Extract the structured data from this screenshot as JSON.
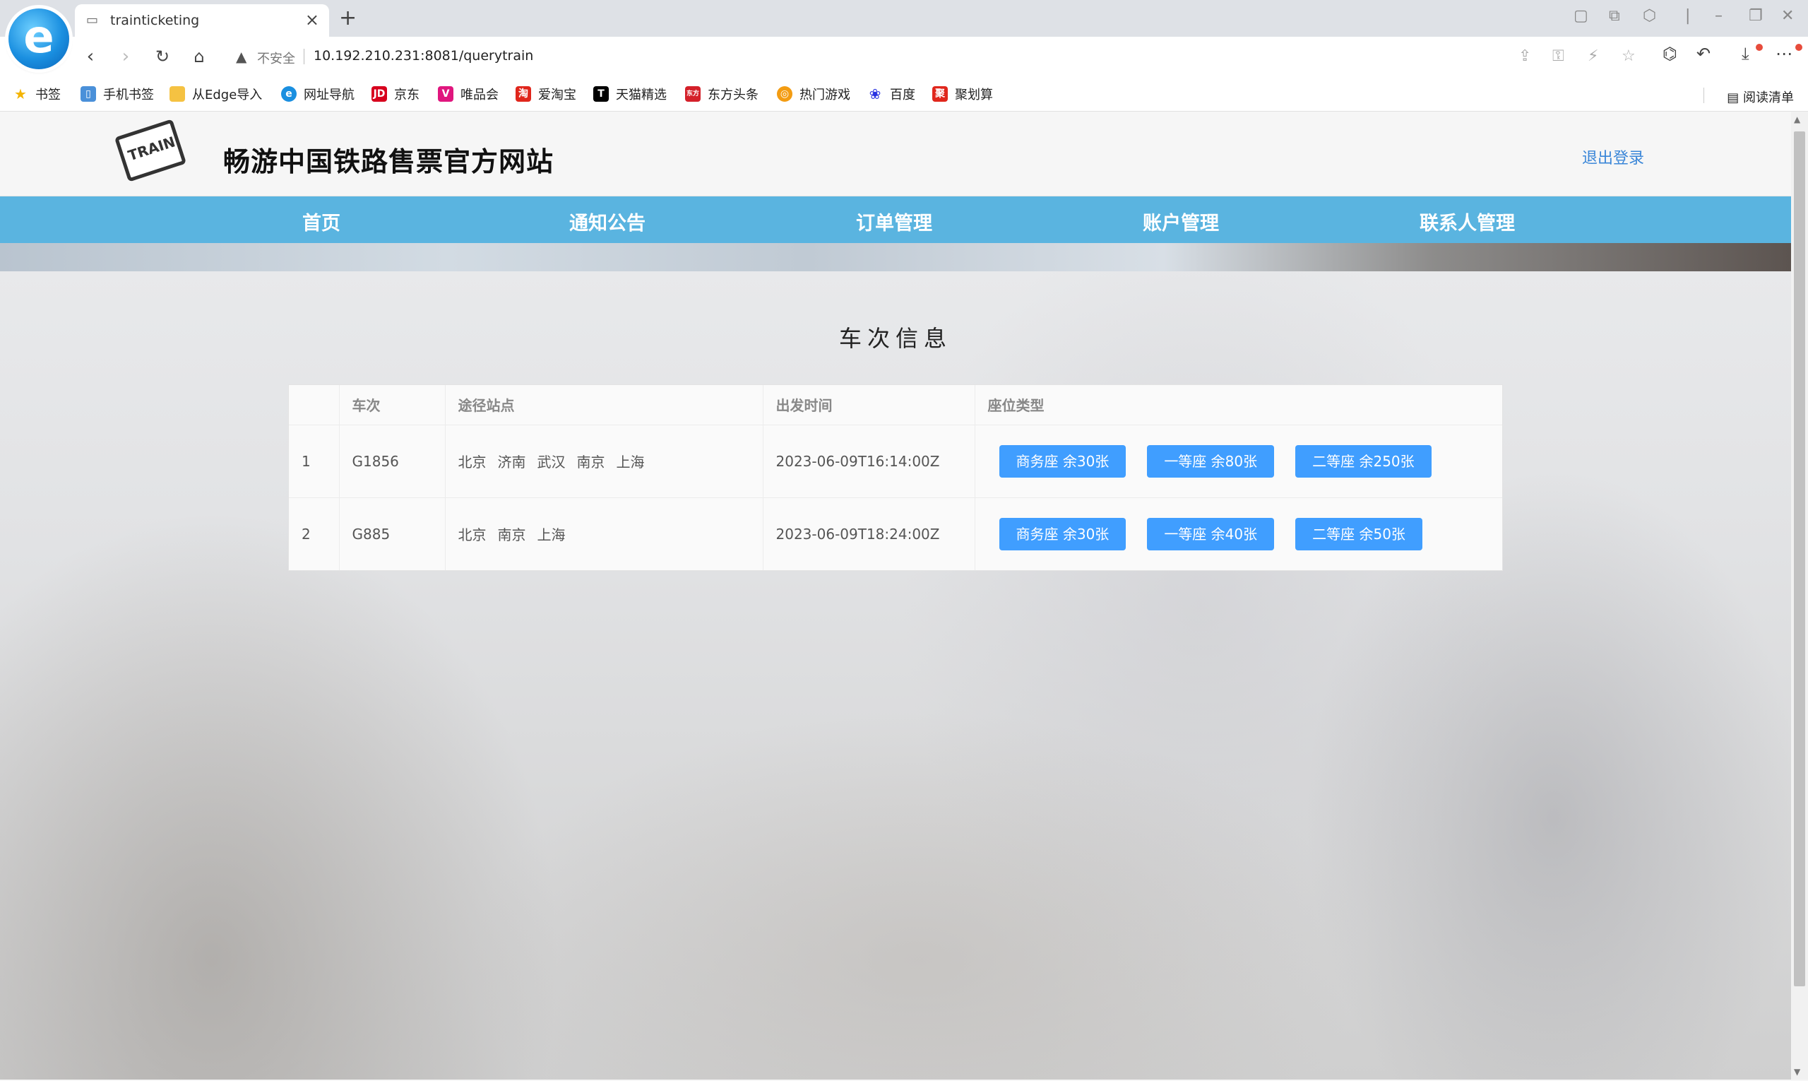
{
  "browser": {
    "tab_title": "trainticketing",
    "insecure_label": "不安全",
    "url": "10.192.210.231:8081/querytrain",
    "bookmarks": [
      {
        "label": "书签"
      },
      {
        "label": "手机书签"
      },
      {
        "label": "从Edge导入"
      },
      {
        "label": "网址导航"
      },
      {
        "label": "京东"
      },
      {
        "label": "唯品会"
      },
      {
        "label": "爱淘宝"
      },
      {
        "label": "天猫精选"
      },
      {
        "label": "东方头条"
      },
      {
        "label": "热门游戏"
      },
      {
        "label": "百度"
      },
      {
        "label": "聚划算"
      }
    ],
    "reading_list": "阅读清单"
  },
  "site": {
    "title": "畅游中国铁路售票官方网站",
    "logo_text": "TRAIN",
    "logout": "退出登录",
    "nav": [
      "首页",
      "通知公告",
      "订单管理",
      "账户管理",
      "联系人管理"
    ]
  },
  "section_title": "车次信息",
  "table": {
    "headers": [
      "",
      "车次",
      "途径站点",
      "出发时间",
      "座位类型"
    ],
    "rows": [
      {
        "index": "1",
        "train": "G1856",
        "stations": [
          "北京",
          "济南",
          "武汉",
          "南京",
          "上海"
        ],
        "depart": "2023-06-09T16:14:00Z",
        "seats": [
          "商务座 余30张",
          "一等座 余80张",
          "二等座 余250张"
        ]
      },
      {
        "index": "2",
        "train": "G885",
        "stations": [
          "北京",
          "南京",
          "上海"
        ],
        "depart": "2023-06-09T18:24:00Z",
        "seats": [
          "商务座 余30张",
          "一等座 余40张",
          "二等座 余50张"
        ]
      }
    ]
  },
  "colors": {
    "navbar": "#5ab4e0",
    "seat_button": "#409eff",
    "logout_link": "#3a86d8"
  }
}
